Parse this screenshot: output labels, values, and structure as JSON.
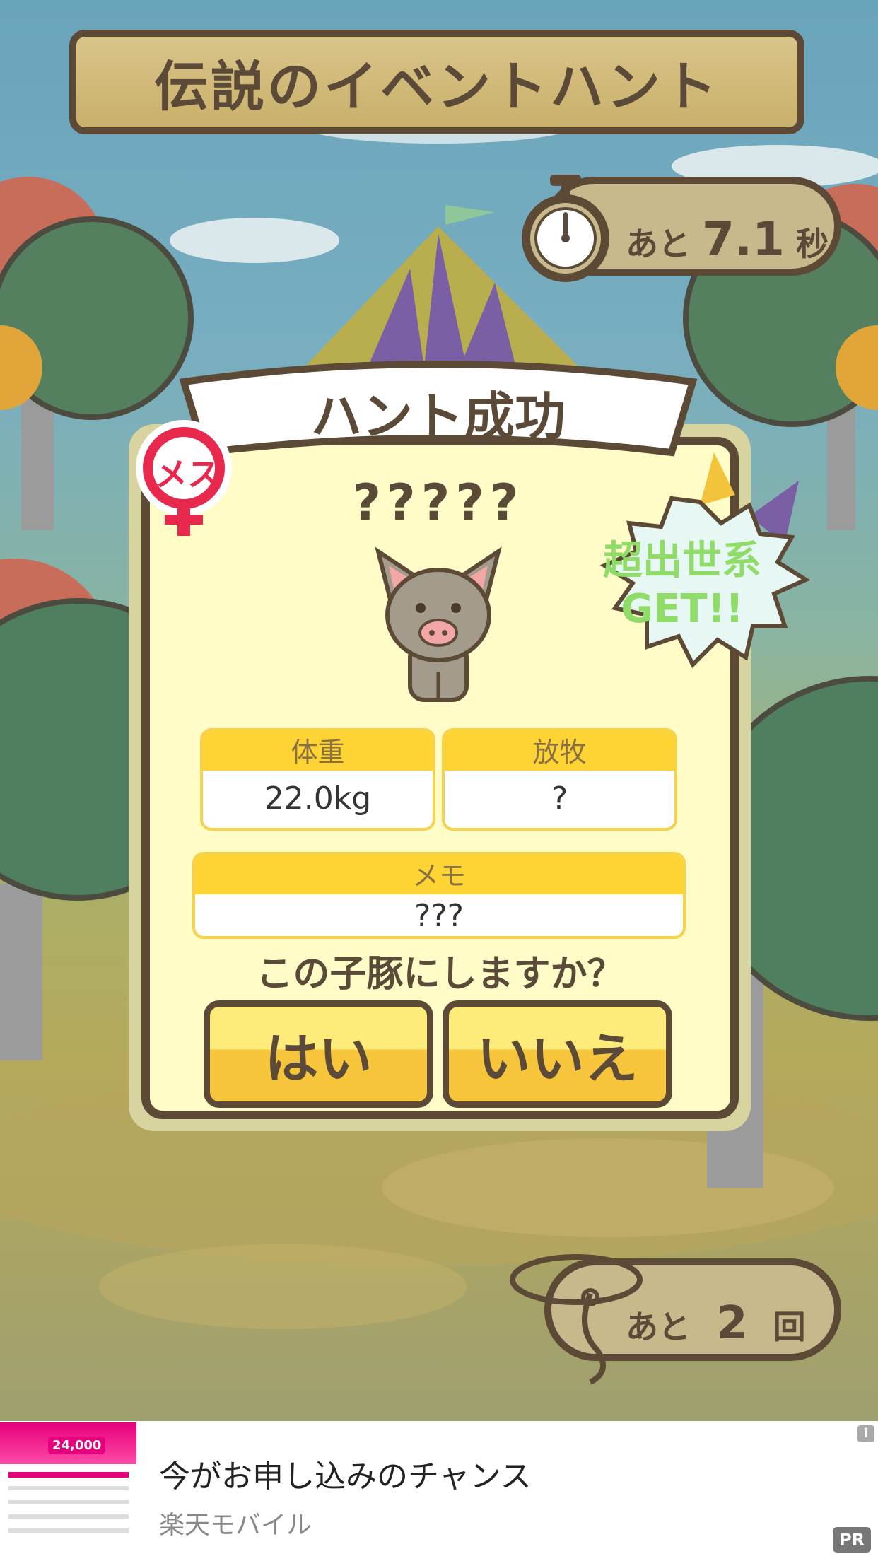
{
  "header": {
    "title": "伝説のイベントハント"
  },
  "timer": {
    "prefix": "あと",
    "value": "7.1",
    "unit": "秒"
  },
  "dialog": {
    "banner": "ハント成功",
    "gender_badge": "メス",
    "rank_badge_line1": "超出世系",
    "rank_badge_line2": "GET!!",
    "pig_name": "?????",
    "stats": [
      {
        "label": "体重",
        "value": "22.0kg"
      },
      {
        "label": "放牧",
        "value": "?"
      }
    ],
    "memo": {
      "label": "メモ",
      "value": "???"
    },
    "question": "この子豚にしますか？",
    "yes_label": "はい",
    "no_label": "いいえ"
  },
  "remaining": {
    "prefix": "あと",
    "value": "2",
    "unit": "回"
  },
  "ad": {
    "title": "今がお申し込みのチャンス",
    "advertiser": "楽天モバイル",
    "pr_label": "PR",
    "info_label": "i",
    "image_price": "24,000"
  },
  "icons": [
    "stopwatch-icon",
    "female-icon",
    "pig-icon",
    "lasso-icon",
    "info-icon"
  ],
  "colors": {
    "accent": "#fdd434",
    "frame": "#5c4a36",
    "panel": "#fffcc8"
  }
}
